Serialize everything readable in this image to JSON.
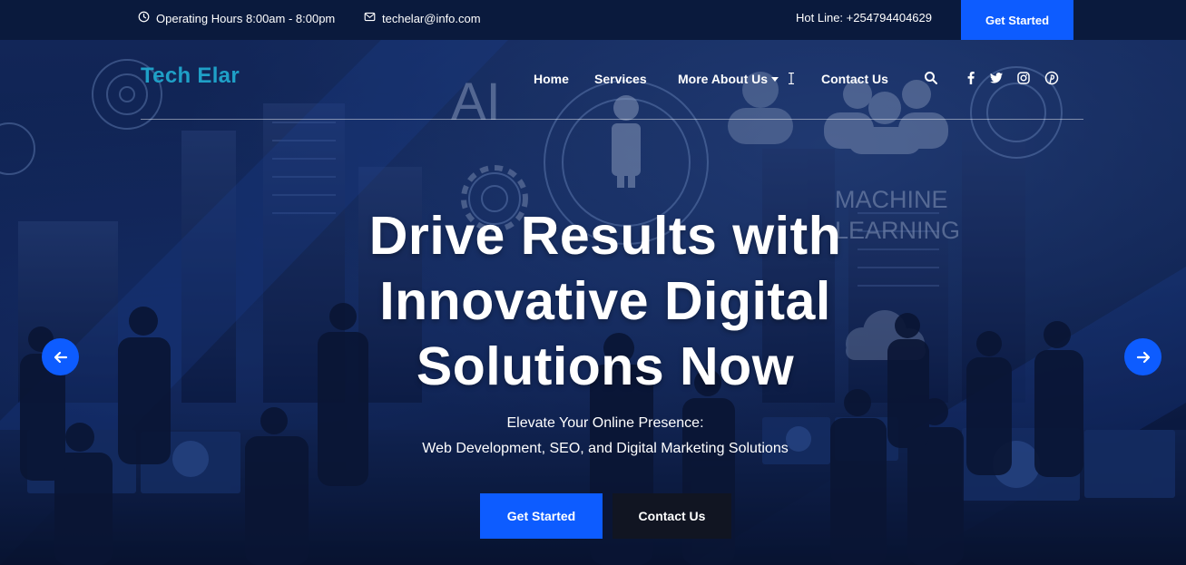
{
  "topbar": {
    "hours": "Operating Hours 8:00am - 8:00pm",
    "email": "techelar@info.com",
    "hotline": "Hot Line: +254794404629",
    "cta": "Get Started"
  },
  "header": {
    "logo": "Tech Elar",
    "nav": {
      "home": "Home",
      "services": "Services",
      "more": "More About Us",
      "contact": "Contact Us"
    },
    "icons": [
      "search-icon",
      "facebook-icon",
      "twitter-icon",
      "instagram-icon",
      "pinterest-icon"
    ]
  },
  "hero": {
    "headline": "Drive Results with Innovative Digital Solutions Now",
    "sub1": "Elevate Your Online Presence:",
    "sub2": "Web Development, SEO, and Digital Marketing Solutions",
    "primary_button": "Get Started",
    "secondary_button": "Contact Us",
    "bg_text_ai": "AI",
    "bg_text_machine": "MACHINE",
    "bg_text_learning": "LEARNING"
  },
  "colors": {
    "accent": "#0d5cff",
    "topbar": "#0a1a3d",
    "logo": "#1fa0c7",
    "dark_button": "#111522"
  }
}
